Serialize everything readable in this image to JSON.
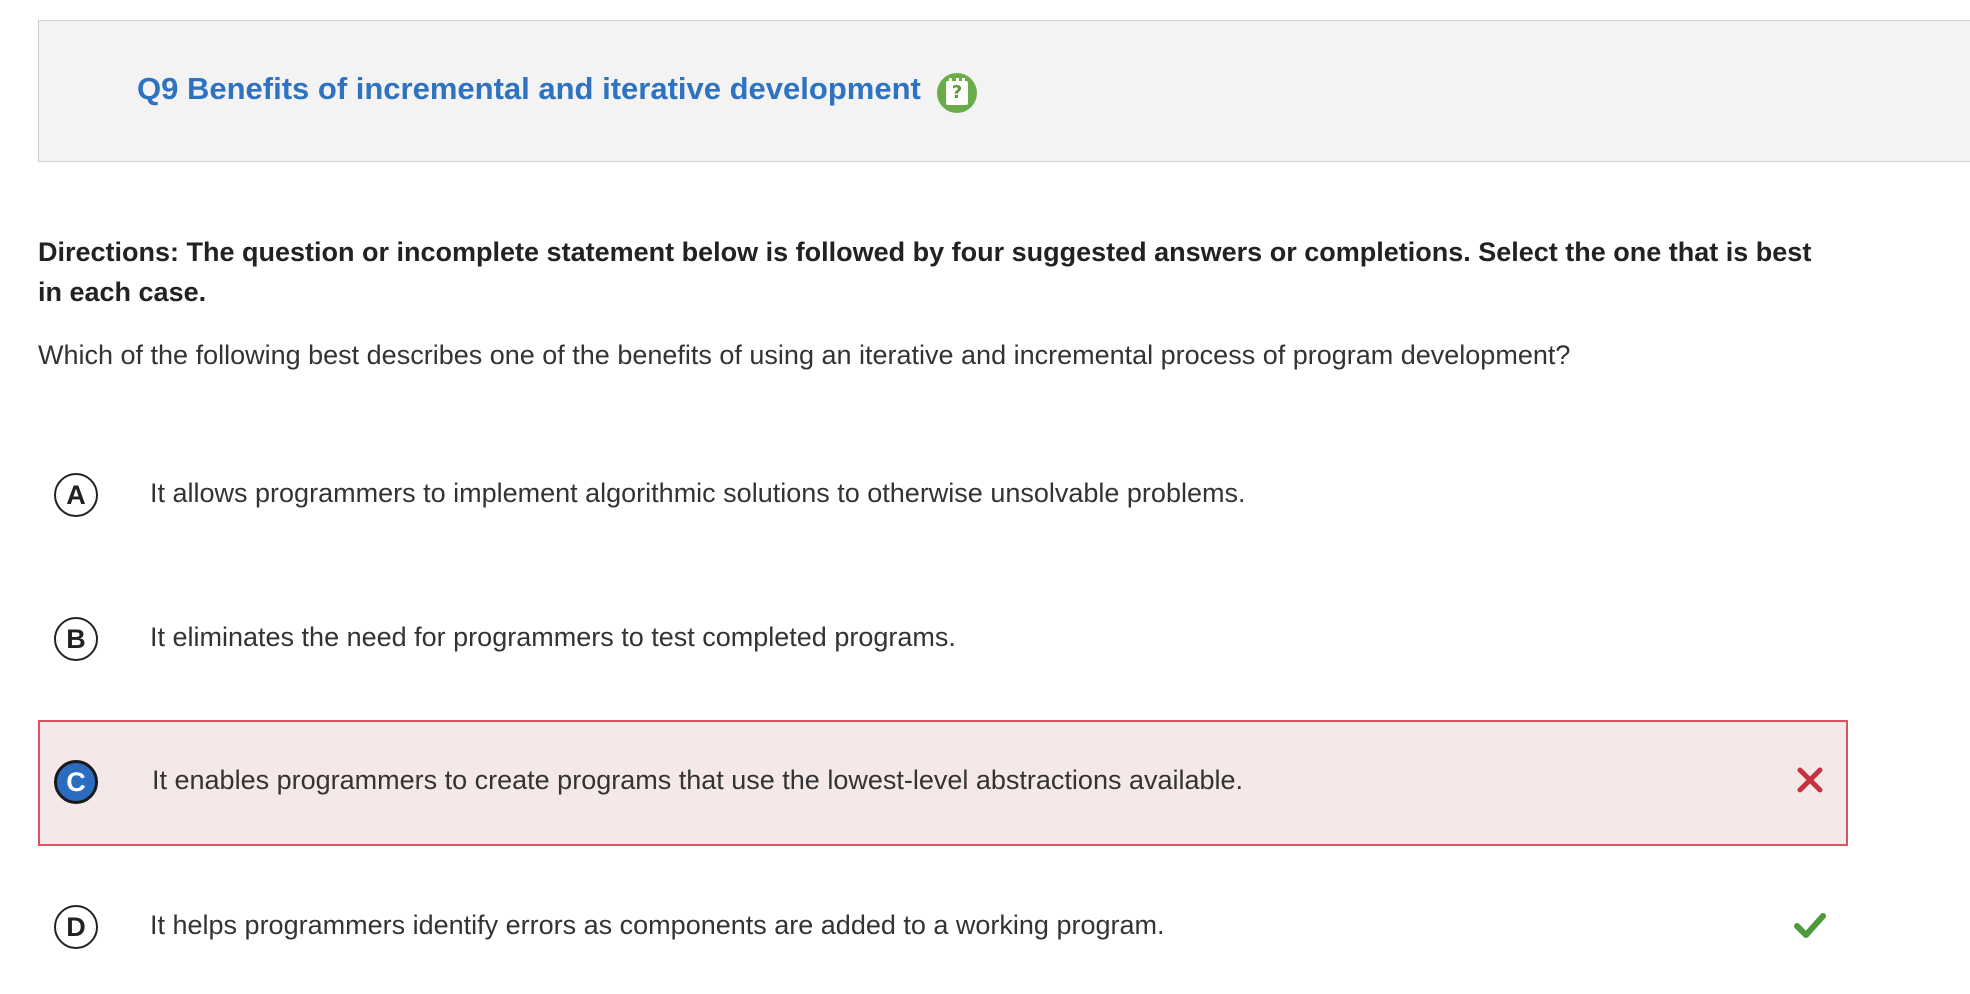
{
  "header": {
    "title": "Q9 Benefits of incremental and iterative development",
    "icon": "help-note-icon",
    "title_color": "#2f72bf",
    "icon_color": "#6aab4a"
  },
  "directions": "Directions: The question or incomplete statement below is followed by four suggested answers or completions. Select the one that is best in each case.",
  "question": "Which of the following best describes one of the benefits of using an iterative and incremental process of program development?",
  "options": [
    {
      "letter": "A",
      "text": "It allows programmers to implement algorithmic solutions to otherwise unsolvable problems.",
      "selected": false,
      "status": ""
    },
    {
      "letter": "B",
      "text": "It eliminates the need for programmers to test completed programs.",
      "selected": false,
      "status": ""
    },
    {
      "letter": "C",
      "text": "It enables programmers to create programs that use the lowest-level abstractions available.",
      "selected": true,
      "status": "incorrect"
    },
    {
      "letter": "D",
      "text": "It helps programmers identify errors as components are added to a working program.",
      "selected": false,
      "status": "correct"
    }
  ],
  "colors": {
    "incorrect": "#c8323c",
    "correct": "#4e9a3a",
    "selected_bg": "#f5e8e8",
    "selected_border": "#d9545f",
    "selected_letter_bg": "#2b6cc0"
  }
}
